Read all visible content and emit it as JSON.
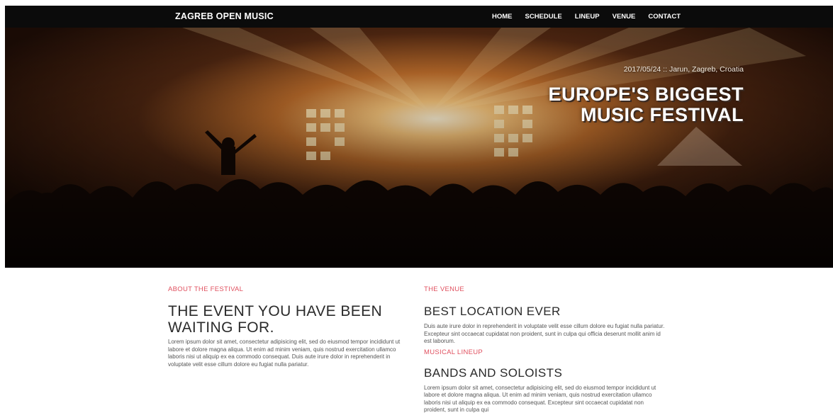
{
  "header": {
    "brand": "ZAGREB OPEN MUSIC",
    "menu": [
      {
        "label": "HOME"
      },
      {
        "label": "SCHEDULE"
      },
      {
        "label": "LINEUP"
      },
      {
        "label": "VENUE"
      },
      {
        "label": "CONTACT"
      }
    ]
  },
  "hero": {
    "date_location": "2017/05/24 :: Jarun, Zagreb, Croatia",
    "title_line1": "EUROPE'S BIGGEST",
    "title_line2": "MUSIC FESTIVAL"
  },
  "about": {
    "kicker": "ABOUT THE FESTIVAL",
    "heading_line1": "THE EVENT YOU HAVE BEEN",
    "heading_line2": "WAITING FOR.",
    "text": "Lorem ipsum dolor sit amet, consectetur adipisicing elit, sed do eiusmod tempor incididunt ut labore et dolore magna aliqua. Ut enim ad minim veniam, quis nostrud exercitation ullamco laboris nisi ut aliquip ex ea commodo consequat. Duis aute irure dolor in reprehenderit in voluptate velit esse cillum dolore eu fugiat nulla pariatur."
  },
  "venue": {
    "kicker": "THE VENUE",
    "heading": "BEST LOCATION EVER",
    "text": "Duis aute irure dolor in reprehenderit in voluptate velit esse cillum dolore eu fugiat nulla pariatur. Excepteur sint occaecat cupidatat non proident, sunt in culpa qui officia deserunt mollit anim id est laborum."
  },
  "lineup": {
    "kicker": "MUSICAL LINEUP",
    "heading": "BANDS AND SOLOISTS",
    "text": "Lorem ipsum dolor sit amet, consectetur adipisicing elit, sed do eiusmod tempor incididunt ut labore et dolore magna aliqua. Ut enim ad minim veniam, quis nostrud exercitation ullamco laboris nisi ut aliquip ex ea commodo consequat. Excepteur sint occaecat cupidatat non proident, sunt in culpa qui"
  }
}
